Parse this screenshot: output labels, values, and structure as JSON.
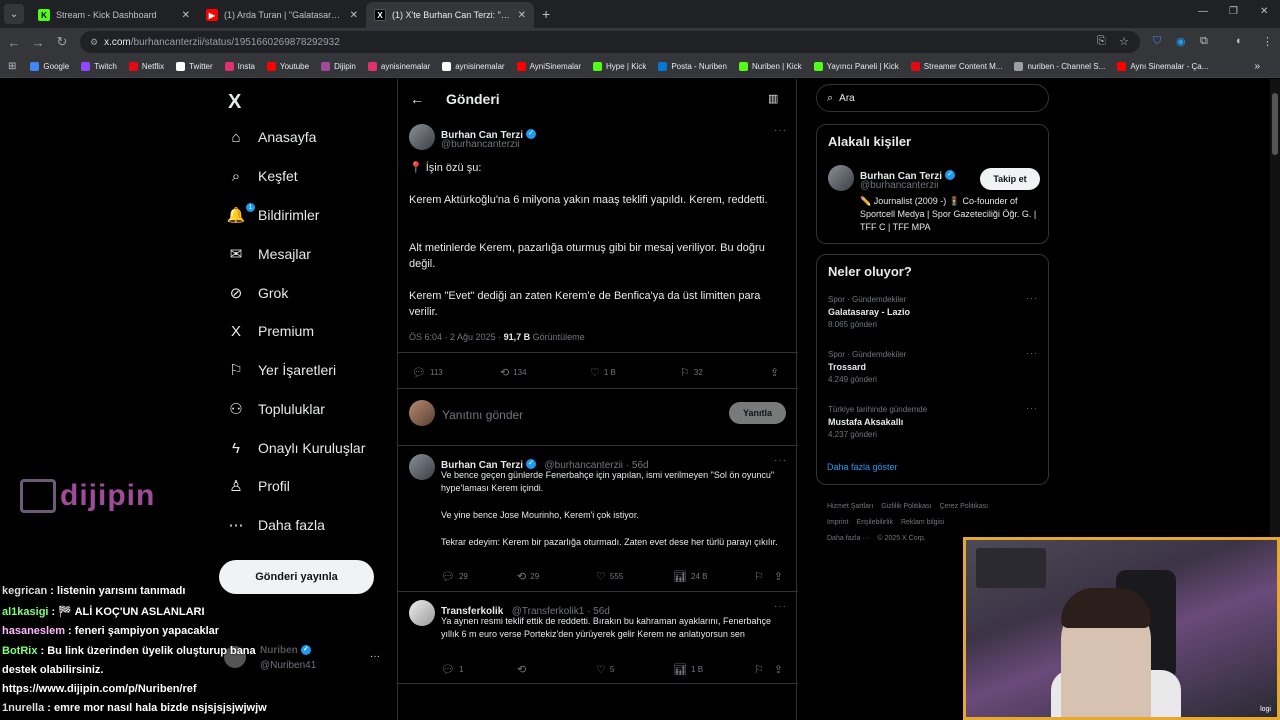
{
  "browser": {
    "tabs": [
      {
        "label": "Stream - Kick Dashboard",
        "favicon_color": "#53fc18",
        "favicon_glyph": "K",
        "active": false
      },
      {
        "label": "(1) Arda Turan | \"Galatasaray'a ...",
        "favicon_color": "#ff0000",
        "favicon_glyph": "▶",
        "active": false
      },
      {
        "label": "(1) X'te Burhan Can Terzi: \"📍 İş...",
        "favicon_color": "#000000",
        "favicon_glyph": "X",
        "active": true
      }
    ],
    "url_host": "x.com",
    "url_path": "/burhancanterzii/status/1951660269878292932",
    "bookmarks": [
      {
        "label": "Google",
        "color": "#4285f4"
      },
      {
        "label": "Twitch",
        "color": "#9146ff"
      },
      {
        "label": "Netflix",
        "color": "#e50914"
      },
      {
        "label": "Twitter",
        "color": "#ffffff"
      },
      {
        "label": "Insta",
        "color": "#e1306c"
      },
      {
        "label": "Youtube",
        "color": "#ff0000"
      },
      {
        "label": "Dijipin",
        "color": "#a04a9a"
      },
      {
        "label": "aynisinemalar",
        "color": "#e1306c"
      },
      {
        "label": "aynisinemalar",
        "color": "#ffffff"
      },
      {
        "label": "AyniSinemalar",
        "color": "#ff0000"
      },
      {
        "label": "Hype | Kick",
        "color": "#53fc18"
      },
      {
        "label": "Posta - Nuriben",
        "color": "#0078d4"
      },
      {
        "label": "Nuriben | Kick",
        "color": "#53fc18"
      },
      {
        "label": "Yayıncı Paneli | Kick",
        "color": "#53fc18"
      },
      {
        "label": "Streamer Content M...",
        "color": "#e50914"
      },
      {
        "label": "nuriben - Channel S...",
        "color": "#9aa0a6"
      },
      {
        "label": "Aynı Sinemalar - Ça...",
        "color": "#ff0000"
      }
    ]
  },
  "sidebar": {
    "logo": "X",
    "items": [
      {
        "label": "Anasayfa",
        "icon": "home-icon",
        "glyph": "⌂"
      },
      {
        "label": "Keşfet",
        "icon": "search-icon",
        "glyph": "⌕"
      },
      {
        "label": "Bildirimler",
        "icon": "bell-icon",
        "glyph": "🔔",
        "badge": "1"
      },
      {
        "label": "Mesajlar",
        "icon": "mail-icon",
        "glyph": "✉"
      },
      {
        "label": "Grok",
        "icon": "grok-icon",
        "glyph": "⊘"
      },
      {
        "label": "Premium",
        "icon": "x-premium-icon",
        "glyph": "X"
      },
      {
        "label": "Yer İşaretleri",
        "icon": "bookmark-icon",
        "glyph": "⚐"
      },
      {
        "label": "Topluluklar",
        "icon": "communities-icon",
        "glyph": "⚇"
      },
      {
        "label": "Onaylı Kuruluşlar",
        "icon": "lightning-icon",
        "glyph": "ϟ"
      },
      {
        "label": "Profil",
        "icon": "profile-icon",
        "glyph": "♙"
      },
      {
        "label": "Daha fazla",
        "icon": "more-circle-icon",
        "glyph": "⋯"
      }
    ],
    "post_button": "Gönderi yayınla",
    "account_name": "Nuriben",
    "account_handle": "@Nuriben41"
  },
  "main": {
    "header_title": "Gönderi",
    "post": {
      "author": "Burhan Can Terzi",
      "handle": "@burhancanterzii",
      "paragraphs": [
        "📍 İşin özü şu:",
        "Kerem Aktürkoğlu'na 6 milyona yakın maaş teklifi yapıldı. Kerem, reddetti.",
        "Alt metinlerde Kerem, pazarlığa oturmuş gibi bir mesaj veriliyor. Bu doğru değil.",
        "Kerem \"Evet\" dediği an zaten Kerem'e de Benfica'ya da üst limitten para verilir."
      ],
      "time": "ÖS 6:04 · 2 Ağu 2025 · ",
      "views": "91,7 B",
      "views_label": " Görüntüleme",
      "replies": "113",
      "reposts": "134",
      "likes": "1 B",
      "bookmarks": "32"
    },
    "reply_placeholder": "Yanıtını gönder",
    "reply_button": "Yanıtla",
    "replies": [
      {
        "author": "Burhan Can Terzi",
        "handle": "@burhancanterzii · 56d",
        "paragraphs": [
          "Ve bence geçen günlerde Fenerbahçe için yapılan, ismi verilmeyen \"Sol ön oyuncu\" hype'laması Kerem içindi.",
          "Ve yine bence Jose Mourinho, Kerem'i çok istiyor.",
          "Tekrar edeyim: Kerem bir pazarlığa oturmadı. Zaten evet dese her türlü parayı çıkılır."
        ],
        "replies": "29",
        "reposts": "29",
        "likes": "555",
        "views": "24 B"
      },
      {
        "author": "Transferkolik",
        "handle": "@Transferkolik1 · 56d",
        "paragraphs": [
          "Ya aynen resmi teklif ettik de reddetti. Bırakın bu kahraman ayaklarını, Fenerbahçe yıllık 6 m euro verse Portekiz'den yürüyerek gelir Kerem ne anlatıyorsun sen"
        ],
        "replies": "1",
        "reposts": "",
        "likes": "5",
        "views": "1 B"
      }
    ]
  },
  "right": {
    "search_placeholder": "Ara",
    "relevant_title": "Alakalı kişiler",
    "person_name": "Burhan Can Terzi",
    "person_handle": "@burhancanterzii",
    "person_bio": "✏️ Journalist (2009 -) 🚦 Co-founder of Sportcell Medya | Spor Gazeteciliği Öğr. G. | TFF C | TFF MPA",
    "follow_button": "Takip et",
    "trends_title": "Neler oluyor?",
    "trends": [
      {
        "category": "Spor · Gündemdekiler",
        "name": "Galatasaray - Lazio",
        "count": "8.065 gönderi"
      },
      {
        "category": "Spor · Gündemdekiler",
        "name": "Trossard",
        "count": "4.249 gönderi"
      },
      {
        "category": "Türkiye tarihinde gündemde",
        "name": "Mustafa Aksakallı",
        "count": "4.237 gönderi"
      }
    ],
    "show_more": "Daha fazla göster",
    "footer_links": [
      "Hizmet Şartları",
      "Gizlilik Politikası",
      "Çerez Politikası",
      "Imprint",
      "Erişilebilirlik",
      "Reklam bilgisi",
      "Daha fazla ···",
      "© 2025 X Corp."
    ]
  },
  "overlay": {
    "dijipin_logo": "dijipin",
    "chat": [
      {
        "user": "kegrican",
        "msg": " : listenin yarısını tanımadı"
      },
      {
        "user": "al1kasigi",
        "msg": " : 🏁 ALİ KOÇ'UN ASLANLARI"
      },
      {
        "user": "hasaneslem",
        "msg": " : feneri şampiyon yapacaklar"
      },
      {
        "user": "BotRix",
        "msg": " : Bu link üzerinden üyelik oluşturup bana"
      },
      {
        "user": "",
        "msg": "destek olabilirsiniz."
      },
      {
        "user": "",
        "msg": "https://www.dijipin.com/p/Nuriben/ref"
      },
      {
        "user": "1nurella",
        "msg": " : emre mor nasıl hala bizde nsjsjsjsjwjwjw"
      }
    ],
    "webcam_label": "logi"
  }
}
